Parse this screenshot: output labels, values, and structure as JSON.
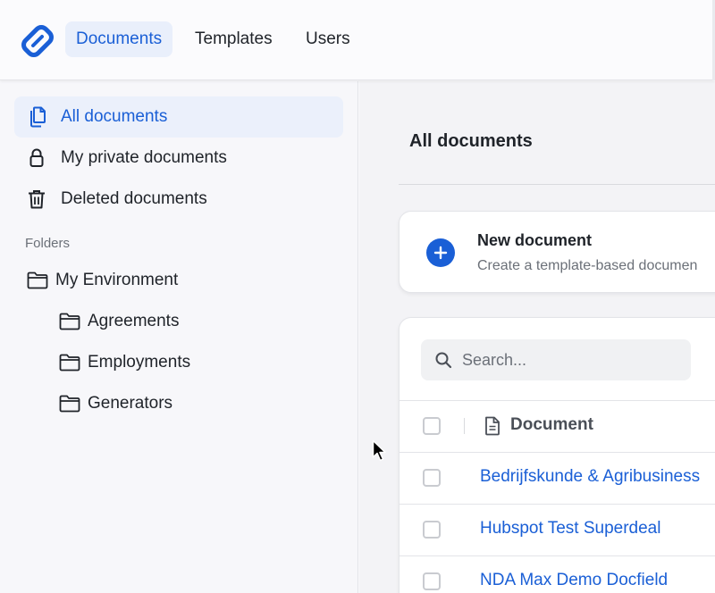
{
  "header": {
    "logo_icon": "diamond-link-logo",
    "tabs": [
      {
        "label": "Documents",
        "active": true
      },
      {
        "label": "Templates",
        "active": false
      },
      {
        "label": "Users",
        "active": false
      }
    ]
  },
  "sidebar": {
    "items": [
      {
        "label": "All documents",
        "icon": "documents-icon",
        "active": true
      },
      {
        "label": "My private documents",
        "icon": "lock-icon",
        "active": false
      },
      {
        "label": "Deleted documents",
        "icon": "trash-icon",
        "active": false
      }
    ],
    "folders_label": "Folders",
    "folders": [
      {
        "label": "My Environment",
        "level": 0
      },
      {
        "label": "Agreements",
        "level": 1
      },
      {
        "label": "Employments",
        "level": 1
      },
      {
        "label": "Generators",
        "level": 1
      }
    ]
  },
  "main": {
    "title": "All documents",
    "new_document": {
      "title": "New document",
      "subtitle": "Create a template-based documen"
    },
    "search": {
      "placeholder": "Search..."
    },
    "table": {
      "column_header": "Document",
      "rows": [
        {
          "name": "Bedrijfskunde & Agribusiness"
        },
        {
          "name": "Hubspot Test Superdeal"
        },
        {
          "name": "NDA Max Demo Docfield"
        }
      ]
    }
  },
  "colors": {
    "accent": "#1a5fd6",
    "active_bg": "#ebf0fb",
    "text": "#1f2329",
    "muted": "#6b7078"
  }
}
